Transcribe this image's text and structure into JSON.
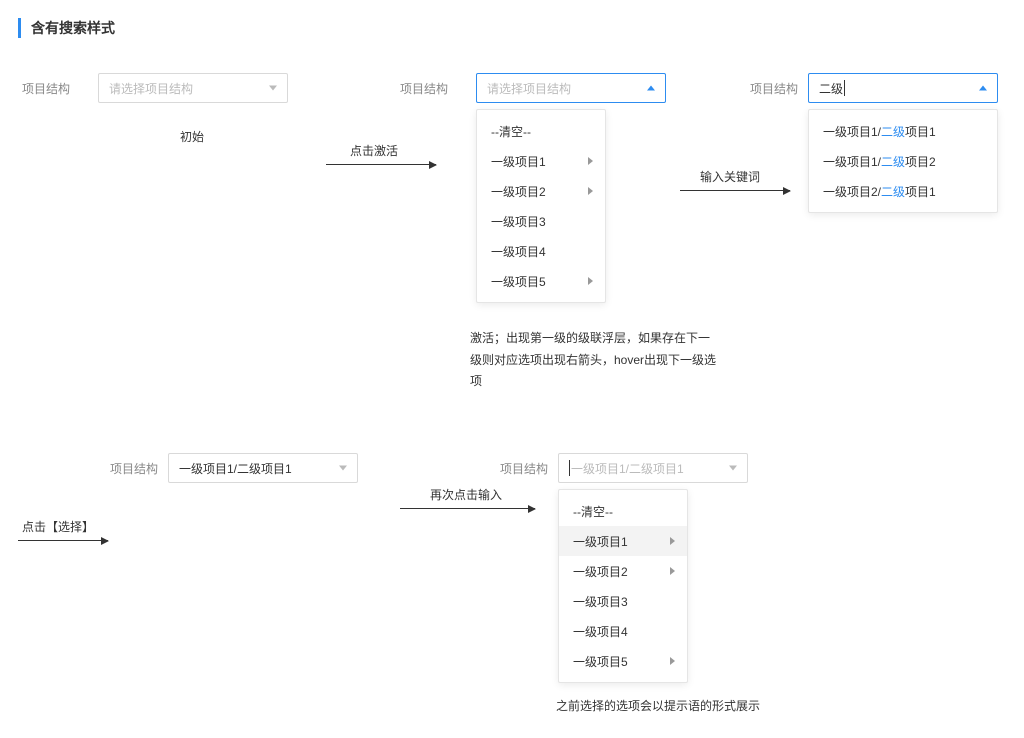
{
  "title": "含有搜索样式",
  "labels": {
    "field": "项目结构",
    "placeholder": "请选择项目结构"
  },
  "state1": {
    "caption": "初始",
    "arrow_label": "点击激活"
  },
  "state2": {
    "clear": "--清空--",
    "options": [
      "一级项目1",
      "一级项目2",
      "一级项目3",
      "一级项目4",
      "一级项目5"
    ],
    "desc": "激活；出现第一级的级联浮层，如果存在下一级则对应选项出现右箭头，hover出现下一级选项",
    "arrow_label": "输入关键词"
  },
  "state3": {
    "keyword": "二级",
    "results": [
      {
        "prefix": "一级项目1/",
        "match": "二级",
        "suffix": "项目1"
      },
      {
        "prefix": "一级项目1/",
        "match": "二级",
        "suffix": "项目2"
      },
      {
        "prefix": "一级项目2/",
        "match": "二级",
        "suffix": "项目1"
      }
    ]
  },
  "state4": {
    "arrow_label": "点击【选择】",
    "value": "一级项目1/二级项目1",
    "arrow2_label": "再次点击输入"
  },
  "state5": {
    "placeholder_value": "一级项目1/二级项目1",
    "clear": "--清空--",
    "options": [
      "一级项目1",
      "一级项目2",
      "一级项目3",
      "一级项目4",
      "一级项目5"
    ],
    "desc": "之前选择的选项会以提示语的形式展示"
  }
}
